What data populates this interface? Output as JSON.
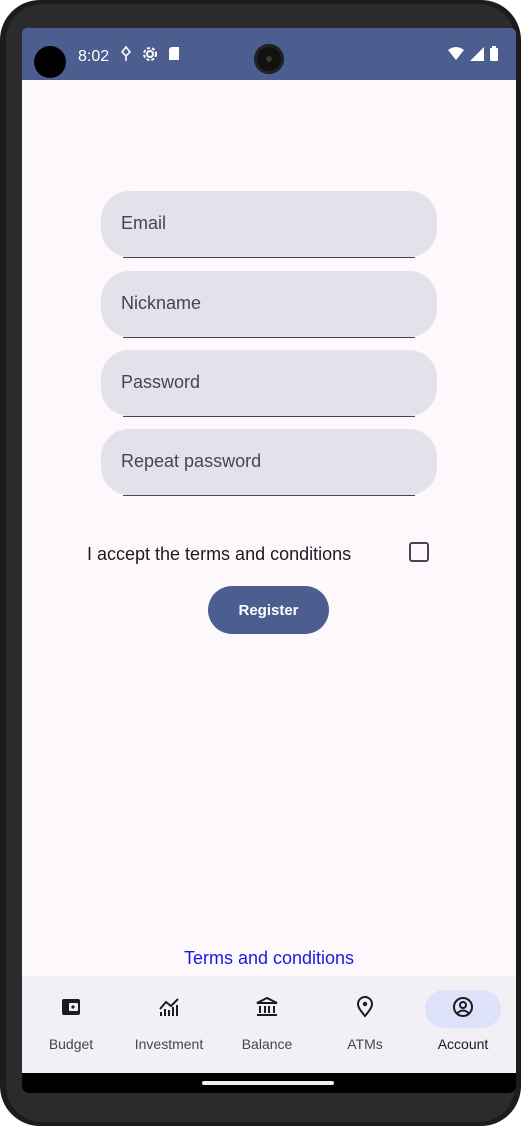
{
  "status_bar": {
    "time": "8:02",
    "icons": [
      "location-icon",
      "settings-icon",
      "sd-card-icon",
      "wifi-icon",
      "signal-icon",
      "battery-icon"
    ]
  },
  "form": {
    "email_label": "Email",
    "nickname_label": "Nickname",
    "password_label": "Password",
    "repeat_password_label": "Repeat password",
    "terms_checkbox_label": "I accept the terms and conditions",
    "terms_checked": false,
    "register_label": "Register"
  },
  "terms_link": "Terms and conditions",
  "bottom_nav": {
    "items": [
      {
        "label": "Budget",
        "icon": "wallet-icon",
        "active": false
      },
      {
        "label": "Investment",
        "icon": "chart-icon",
        "active": false
      },
      {
        "label": "Balance",
        "icon": "bank-icon",
        "active": false
      },
      {
        "label": "ATMs",
        "icon": "location-pin-icon",
        "active": false
      },
      {
        "label": "Account",
        "icon": "account-circle-icon",
        "active": true
      }
    ]
  },
  "colors": {
    "primary": "#4b5e8f",
    "field_bg": "#e3e2ea",
    "link": "#1a1adf",
    "active_indicator": "#dde1f9"
  }
}
